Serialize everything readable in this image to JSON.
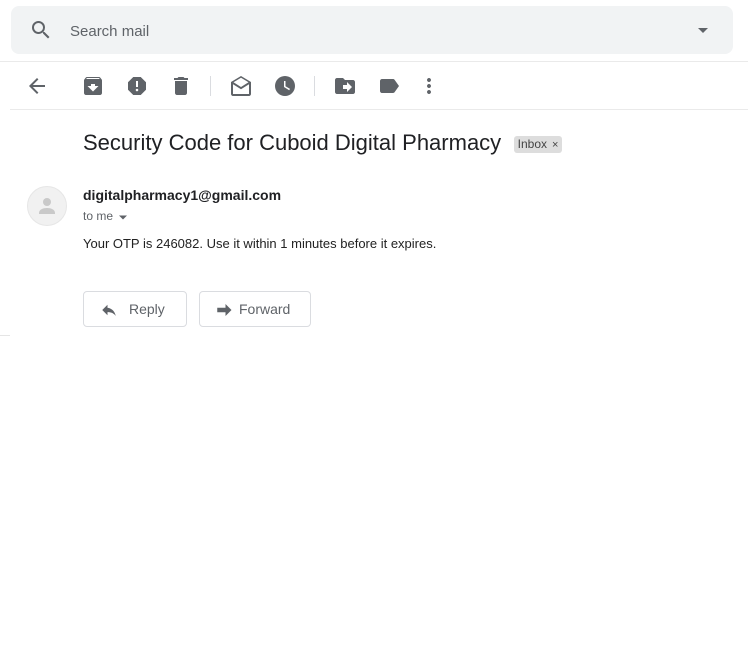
{
  "search": {
    "placeholder": "Search mail"
  },
  "toolbar": {
    "buttons": [
      "back",
      "archive",
      "report-spam",
      "delete",
      "mark-as-unread",
      "snooze",
      "move-to",
      "labels",
      "more"
    ]
  },
  "email": {
    "subject": "Security Code for Cuboid Digital Pharmacy",
    "label": "Inbox",
    "label_close": "×",
    "sender": "digitalpharmacy1@gmail.com",
    "recipient_text": "to me",
    "body": "Your OTP is 246082. Use it within 1 minutes before it expires."
  },
  "actions": {
    "reply": "Reply",
    "forward": "Forward"
  },
  "colors": {
    "icon": "#5f6368",
    "search_bg": "#f1f3f4",
    "chip_bg": "#dddddd"
  }
}
